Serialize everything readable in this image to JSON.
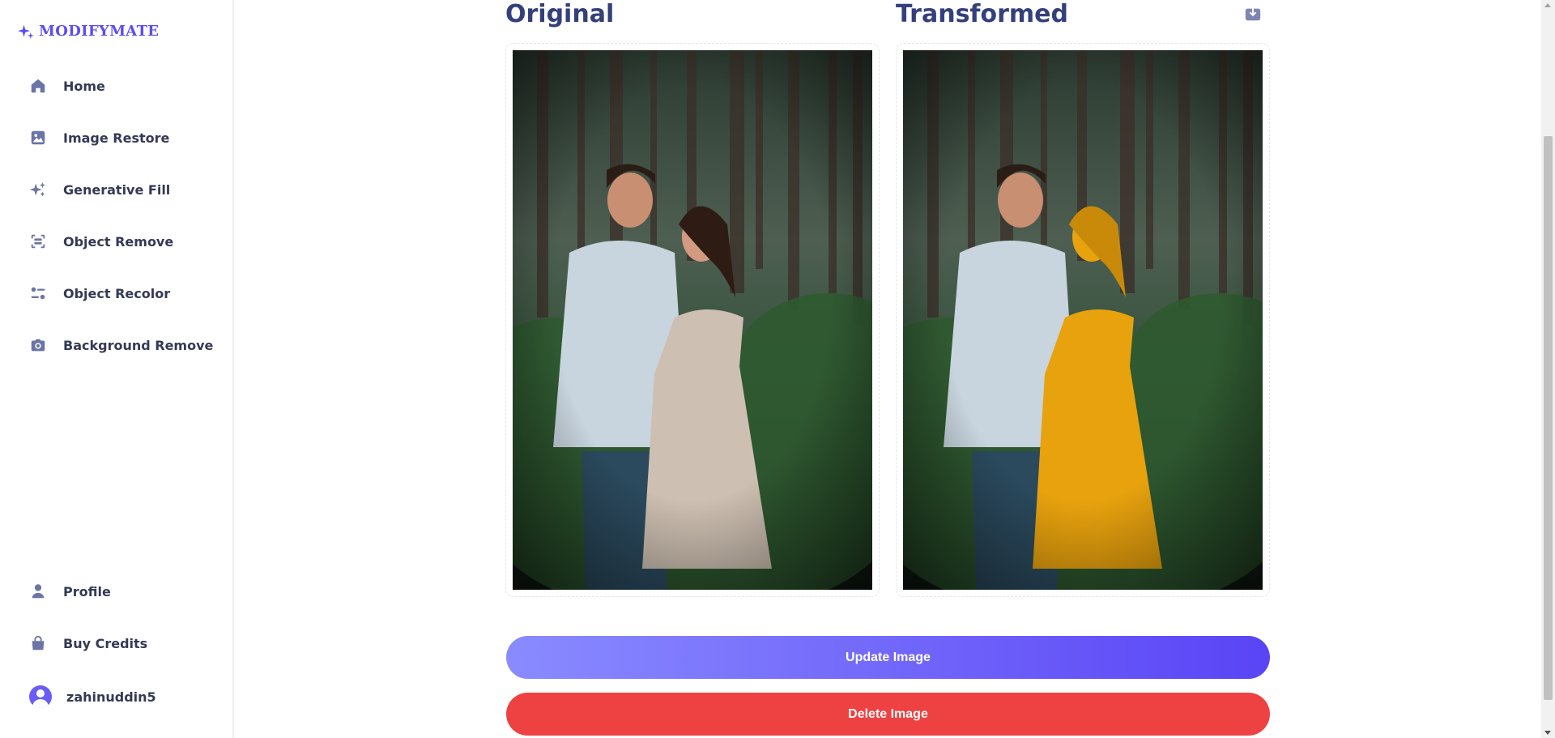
{
  "app": {
    "brand": "MODIFYMATE",
    "brand_color": "#5b4df3"
  },
  "sidebar": {
    "items": [
      {
        "label": "Home",
        "icon": "home-icon"
      },
      {
        "label": "Image Restore",
        "icon": "image-icon"
      },
      {
        "label": "Generative Fill",
        "icon": "sparkles-icon"
      },
      {
        "label": "Object Remove",
        "icon": "scan-icon"
      },
      {
        "label": "Object Recolor",
        "icon": "filter-icon"
      },
      {
        "label": "Background Remove",
        "icon": "camera-icon"
      }
    ],
    "bottom_items": [
      {
        "label": "Profile",
        "icon": "user-icon"
      },
      {
        "label": "Buy Credits",
        "icon": "shopping-bag-icon"
      }
    ],
    "user": {
      "name": "zahinuddin5",
      "icon": "avatar-icon"
    }
  },
  "main": {
    "original_title": "Original",
    "transformed_title": "Transformed",
    "download_icon": "download-icon",
    "recolor_color": "#e8a20e",
    "update_label": "Update Image",
    "delete_label": "Delete Image",
    "update_gradient": [
      "#8a8bff",
      "#5a44f6"
    ],
    "delete_color": "#ee4142"
  }
}
